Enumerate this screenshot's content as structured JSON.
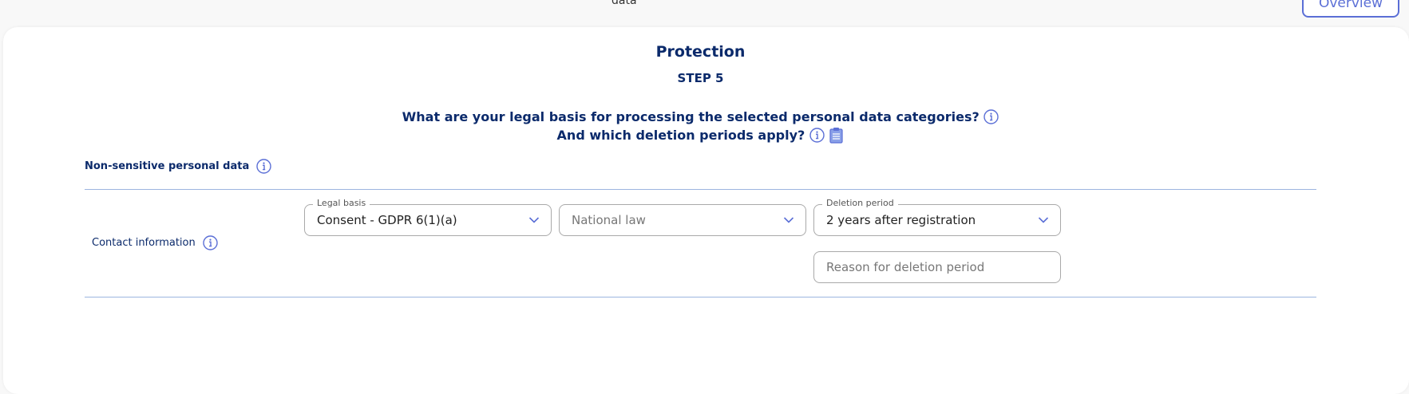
{
  "top": {
    "data_label": "data",
    "overview_button": "Overview"
  },
  "header": {
    "title": "Protection",
    "step": "STEP 5",
    "question_line1": "What are your legal basis for processing the selected personal data categories?",
    "question_line2": "And which deletion periods apply?"
  },
  "section": {
    "title": "Non-sensitive personal data"
  },
  "row": {
    "label": "Contact information",
    "legal_basis": {
      "legend": "Legal basis",
      "value": "Consent - GDPR 6(1)(a)"
    },
    "national_law": {
      "placeholder": "National law"
    },
    "deletion_period": {
      "legend": "Deletion period",
      "value": "2 years after registration"
    },
    "reason": {
      "placeholder": "Reason for deletion period"
    }
  },
  "colors": {
    "primary_text": "#0b2a6b",
    "accent": "#5b6fd6",
    "divider": "#9cb5e0"
  }
}
